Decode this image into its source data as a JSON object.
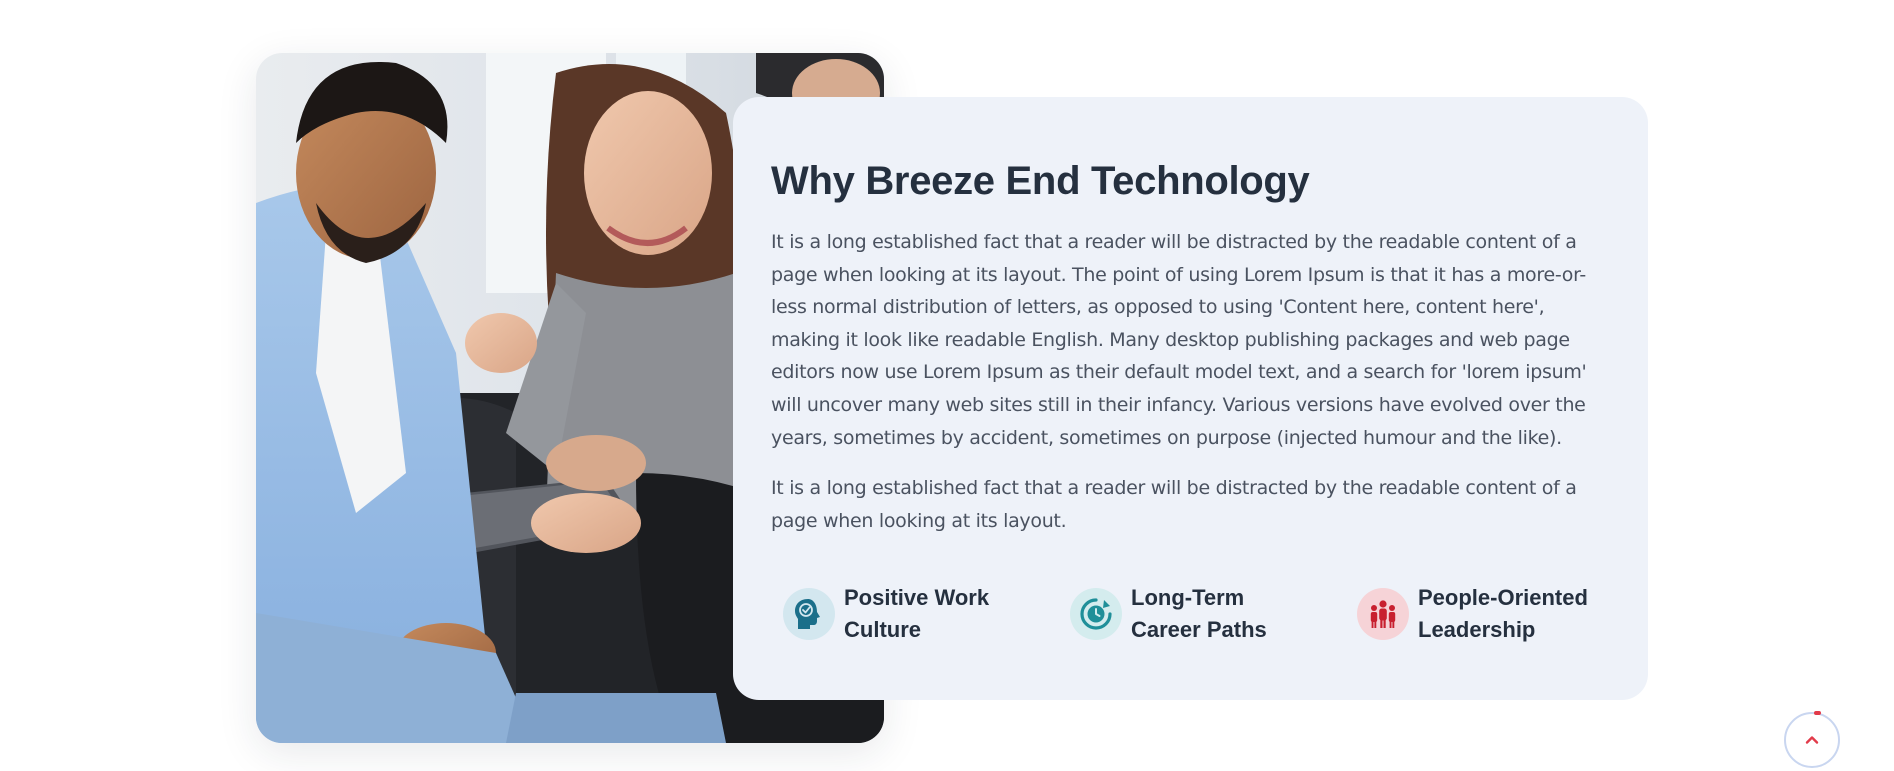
{
  "section": {
    "title": "Why Breeze End Technology",
    "paragraphs": [
      "It is a long established fact that a reader will be distracted by the readable content of a page when looking at its layout. The point of using Lorem Ipsum is that it has a more-or-less normal distribution of letters, as opposed to using 'Content here, content here', making it look like readable English. Many desktop publishing packages and web page editors now use Lorem Ipsum as their default model text, and a search for 'lorem ipsum' will uncover many web sites still in their infancy. Various versions have evolved over the years, sometimes by accident, sometimes on purpose (injected humour and the like).",
      "It is a long established fact that a reader will be distracted by the readable content of a page when looking at its layout."
    ],
    "features": [
      {
        "label": "Positive Work\nCulture",
        "icon": "head-check-icon",
        "color": "#1b6f8a",
        "bg": "#d3e7ef"
      },
      {
        "label": "Long-Term\nCareer Paths",
        "icon": "clock-refresh-icon",
        "color": "#1f8f99",
        "bg": "#d4ecee"
      },
      {
        "label": "People-Oriented\nLeadership",
        "icon": "people-icon",
        "color": "#c8202f",
        "bg": "#f6d3d7"
      }
    ]
  },
  "photo": {
    "description_icon": "team-photo"
  },
  "scroll_top": {
    "icon": "chevron-up-icon",
    "accent": "#e23b4a"
  },
  "colors": {
    "card_bg": "#eef2f9",
    "heading": "#25303f",
    "body_text": "#4a5260"
  }
}
